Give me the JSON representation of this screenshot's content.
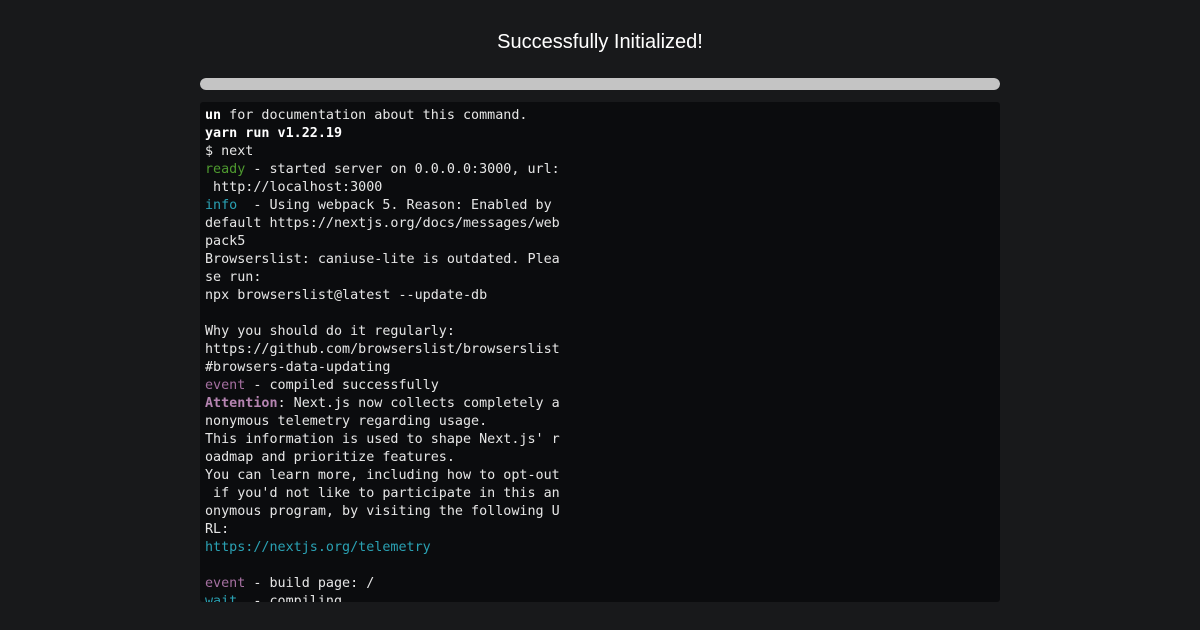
{
  "header": {
    "title": "Successfully Initialized!"
  },
  "progress": {
    "value": 1.0,
    "fill_color": "#c4c4c4"
  },
  "terminal": {
    "lines": [
      [
        {
          "text": "un",
          "style": "bold"
        },
        {
          "text": " for documentation about this command."
        }
      ],
      [
        {
          "text": "yarn run v1.22.19",
          "style": "bold"
        }
      ],
      [
        {
          "text": "$ next"
        }
      ],
      [
        {
          "text": "ready",
          "style": "green"
        },
        {
          "text": " - started server on 0.0.0.0:3000, url:"
        }
      ],
      [
        {
          "text": " http://localhost:3000"
        }
      ],
      [
        {
          "text": "info ",
          "style": "cyan"
        },
        {
          "text": " - Using webpack 5. Reason: Enabled by"
        }
      ],
      [
        {
          "text": "default https://nextjs.org/docs/messages/web"
        }
      ],
      [
        {
          "text": "pack5"
        }
      ],
      [
        {
          "text": "Browserslist: caniuse-lite is outdated. Plea"
        }
      ],
      [
        {
          "text": "se run:"
        }
      ],
      [
        {
          "text": "npx browserslist@latest --update-db"
        }
      ],
      [
        {
          "text": ""
        }
      ],
      [
        {
          "text": "Why you should do it regularly:"
        }
      ],
      [
        {
          "text": "https://github.com/browserslist/browserslist"
        }
      ],
      [
        {
          "text": "#browsers-data-updating"
        }
      ],
      [
        {
          "text": "event",
          "style": "magenta"
        },
        {
          "text": " - compiled successfully"
        }
      ],
      [
        {
          "text": "Attention",
          "style": "magenta-bold"
        },
        {
          "text": ": Next.js now collects completely a"
        }
      ],
      [
        {
          "text": "nonymous telemetry regarding usage."
        }
      ],
      [
        {
          "text": "This information is used to shape Next.js' r"
        }
      ],
      [
        {
          "text": "oadmap and prioritize features."
        }
      ],
      [
        {
          "text": "You can learn more, including how to opt-out"
        }
      ],
      [
        {
          "text": " if you'd not like to participate in this an"
        }
      ],
      [
        {
          "text": "onymous program, by visiting the following U"
        }
      ],
      [
        {
          "text": "RL:"
        }
      ],
      [
        {
          "text": "https://nextjs.org/telemetry",
          "style": "cyan"
        }
      ],
      [
        {
          "text": ""
        }
      ],
      [
        {
          "text": "event",
          "style": "magenta"
        },
        {
          "text": " - build page: /"
        }
      ],
      [
        {
          "text": "wait ",
          "style": "cyan"
        },
        {
          "text": " - compiling..."
        }
      ]
    ]
  }
}
